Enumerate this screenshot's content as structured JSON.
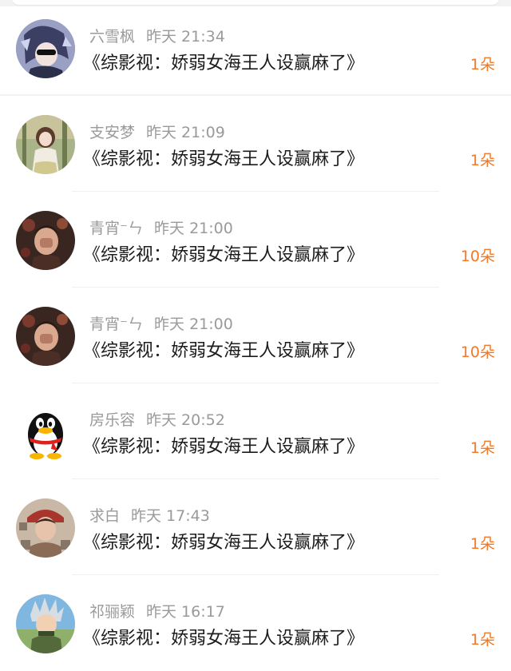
{
  "messages": [
    {
      "name": "六雪枫",
      "time": "昨天 21:34",
      "text": "《综影视：娇弱女海王人设赢麻了》",
      "count": "1朵",
      "avatar": "anime-boy-avatar"
    },
    {
      "name": "支安梦",
      "time": "昨天 21:09",
      "text": "《综影视：娇弱女海王人设赢麻了》",
      "count": "1朵",
      "avatar": "girl-in-forest-avatar"
    },
    {
      "name": "青宵⁻ㄣ",
      "time": "昨天 21:00",
      "text": "《综影视：娇弱女海王人设赢麻了》",
      "count": "10朵",
      "avatar": "girl-with-flowers-avatar"
    },
    {
      "name": "青宵⁻ㄣ",
      "time": "昨天 21:00",
      "text": "《综影视：娇弱女海王人设赢麻了》",
      "count": "10朵",
      "avatar": "girl-with-flowers-avatar"
    },
    {
      "name": "房乐容",
      "time": "昨天 20:52",
      "text": "《综影视：娇弱女海王人设赢麻了》",
      "count": "1朵",
      "avatar": "penguin-avatar"
    },
    {
      "name": "求白",
      "time": "昨天 17:43",
      "text": "《综影视：娇弱女海王人设赢麻了》",
      "count": "1朵",
      "avatar": "woman-with-text-avatar"
    },
    {
      "name": "祁骊颖",
      "time": "昨天 16:17",
      "text": "《综影视：娇弱女海王人设赢麻了》",
      "count": "1朵",
      "avatar": "silver-hair-boy-avatar"
    }
  ],
  "colors": {
    "name": "#9a9a9a",
    "message": "#1c1c1c",
    "count": "#f07a2a",
    "divider": "#efefef"
  }
}
